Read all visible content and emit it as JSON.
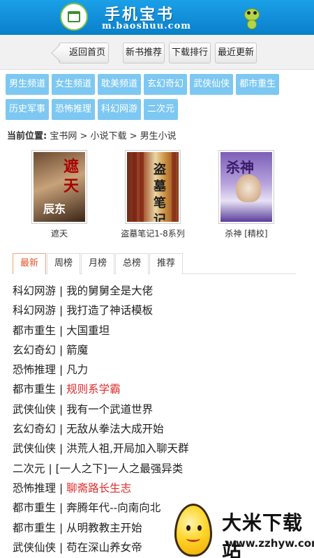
{
  "header": {
    "title": "手机宝书",
    "url": "m.baoshuu.com"
  },
  "topnav": {
    "back": "返回首页",
    "new_books": "新书推荐",
    "download_rank": "下载排行",
    "recent_update": "最近更新"
  },
  "categories": [
    "男生频道",
    "女生频道",
    "耽美频道",
    "玄幻奇幻",
    "武侠仙侠",
    "都市重生",
    "历史军事",
    "恐怖推理",
    "科幻网游",
    "二次元"
  ],
  "location": {
    "label": "当前位置:",
    "path": "宝书网 > 小说下载 > 男生小说"
  },
  "books": [
    {
      "title": "遮天",
      "cover_text": "遮天",
      "cover_author": "辰东"
    },
    {
      "title": "盗墓笔记1-8系列",
      "cover_text": "盗墓笔记"
    },
    {
      "title": "杀神 [精校]",
      "cover_text": "杀神"
    }
  ],
  "tabs": [
    "最新",
    "周榜",
    "月榜",
    "总榜",
    "推荐"
  ],
  "list": [
    {
      "cat": "科幻网游",
      "name": "我的舅舅全是大佬",
      "hot": false
    },
    {
      "cat": "科幻网游",
      "name": "我打造了神话模板",
      "hot": false
    },
    {
      "cat": "都市重生",
      "name": "大国重坦",
      "hot": false
    },
    {
      "cat": "玄幻奇幻",
      "name": "箭魔",
      "hot": false
    },
    {
      "cat": "恐怖推理",
      "name": "凡力",
      "hot": false
    },
    {
      "cat": "都市重生",
      "name": "规则系学霸",
      "hot": true
    },
    {
      "cat": "武侠仙侠",
      "name": "我有一个武道世界",
      "hot": false
    },
    {
      "cat": "玄幻奇幻",
      "name": "无敌从拳法大成开始",
      "hot": false
    },
    {
      "cat": "武侠仙侠",
      "name": "洪荒人祖,开局加入聊天群",
      "hot": false
    },
    {
      "cat": "二次元",
      "name": "[一人之下]一人之最强异类",
      "hot": false
    },
    {
      "cat": "恐怖推理",
      "name": "聊斋路长生志",
      "hot": true
    },
    {
      "cat": "都市重生",
      "name": "奔腾年代--向南向北",
      "hot": false
    },
    {
      "cat": "都市重生",
      "name": "从明教教主开始",
      "hot": false
    },
    {
      "cat": "武侠仙侠",
      "name": "苟在深山养女帝",
      "hot": false
    }
  ],
  "watermark": {
    "brand": "大米下载站",
    "site": "www.zzhyw.com"
  }
}
